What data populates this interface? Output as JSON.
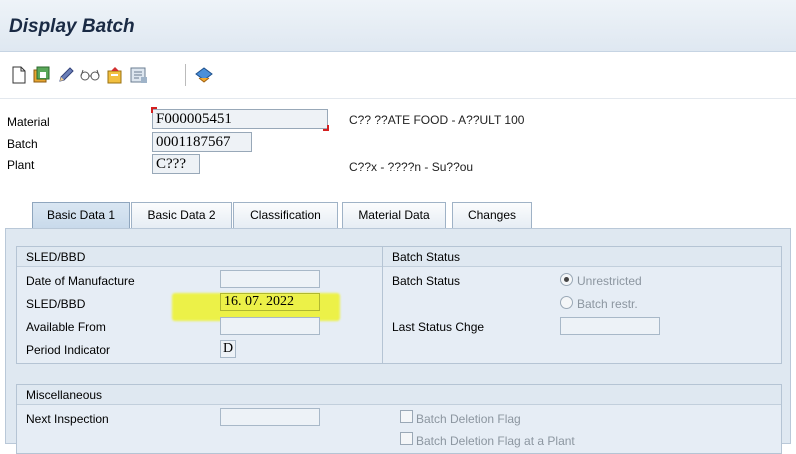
{
  "window": {
    "title": "Display Batch"
  },
  "toolbar": {
    "icons": [
      "new-document-icon",
      "other-batch-icon",
      "edit-pencil-icon",
      "glasses-display-icon",
      "where-used-icon",
      "batch-info-icon",
      "classification-icon"
    ]
  },
  "header": {
    "material_label": "Material",
    "material_value": "F000005451",
    "material_desc": "C?? ??ATE FOOD - A??ULT 100",
    "batch_label": "Batch",
    "batch_value": "0001187567",
    "plant_label": "Plant",
    "plant_value": "C???",
    "plant_desc": "C??x - ????n - Su??ou"
  },
  "tabs": [
    {
      "label": "Basic Data 1"
    },
    {
      "label": "Basic Data 2"
    },
    {
      "label": "Classification"
    },
    {
      "label": "Material Data"
    },
    {
      "label": "Changes"
    }
  ],
  "sled_group": {
    "title": "SLED/BBD",
    "date_of_manufacture_label": "Date of Manufacture",
    "date_of_manufacture_value": "",
    "sled_label": "SLED/BBD",
    "sled_value": "16. 07. 2022",
    "available_from_label": "Available From",
    "available_from_value": "",
    "period_indicator_label": "Period Indicator",
    "period_indicator_value": "D"
  },
  "status_group": {
    "title": "Batch Status",
    "batch_status_label": "Batch Status",
    "unrestricted_label": "Unrestricted",
    "restricted_label": "Batch restr.",
    "last_status_change_label": "Last Status Chge",
    "last_status_change_value": ""
  },
  "misc_group": {
    "title": "Miscellaneous",
    "next_inspection_label": "Next Inspection",
    "next_inspection_value": "",
    "deletion_flag_label": "Batch Deletion Flag",
    "deletion_flag_plant_label": "Batch Deletion Flag at a Plant"
  },
  "colors": {
    "highlight": "#eef22a",
    "focus_marker": "#d42020",
    "panel_bg": "#dfe8f1"
  }
}
